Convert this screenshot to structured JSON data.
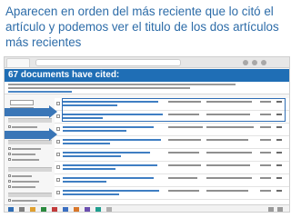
{
  "slide": {
    "title": "Aparecen en orden del más reciente que lo citó el artículo y podemos ver el titulo de los dos artículos más recientes"
  },
  "screenshot": {
    "banner_text": "67 documents have cited:"
  },
  "colors": {
    "title": "#2d6ca8",
    "banner": "#1f6eb5",
    "arrow": "#3a76b7",
    "highlight": "#2f6db5",
    "link": "#3f7ec2"
  },
  "icons": [
    "browser-tab-icon",
    "windows-start-icon",
    "taskbar-app-icon",
    "arrow-right-icon"
  ]
}
